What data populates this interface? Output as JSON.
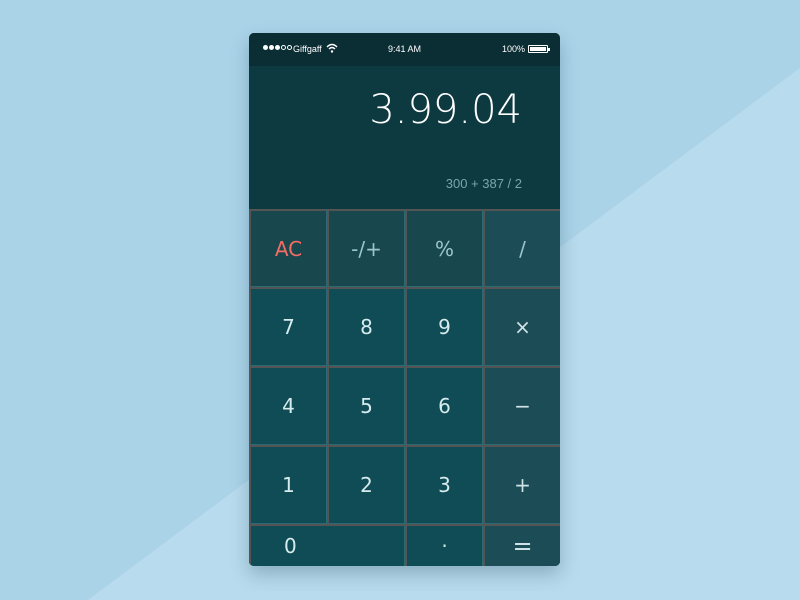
{
  "status_bar": {
    "carrier": "Giffgaff",
    "time": "9:41 AM",
    "battery": "100%",
    "signal_strength": 3,
    "signal_total": 5
  },
  "display": {
    "result": "3.99.04",
    "expression": "300 + 387 / 2"
  },
  "keypad": {
    "ac": "AC",
    "negate": "-/+",
    "percent": "%",
    "divide": "/",
    "seven": "7",
    "eight": "8",
    "nine": "9",
    "multiply": "×",
    "four": "4",
    "five": "5",
    "six": "6",
    "minus": "−",
    "one": "1",
    "two": "2",
    "three": "3",
    "plus": "+",
    "zero": "0",
    "decimal": "·",
    "equals": "="
  },
  "colors": {
    "background": "#abd3e8",
    "phone_body": "#0f4c55",
    "display": "#0d3a41",
    "status_bar": "#0b2e35",
    "operator_key": "#1c4c55",
    "function_key": "#18474e",
    "clear_accent": "#f36d64"
  },
  "icons": {
    "wifi": "wifi-icon",
    "battery": "battery-icon",
    "signal": "signal-icon"
  }
}
